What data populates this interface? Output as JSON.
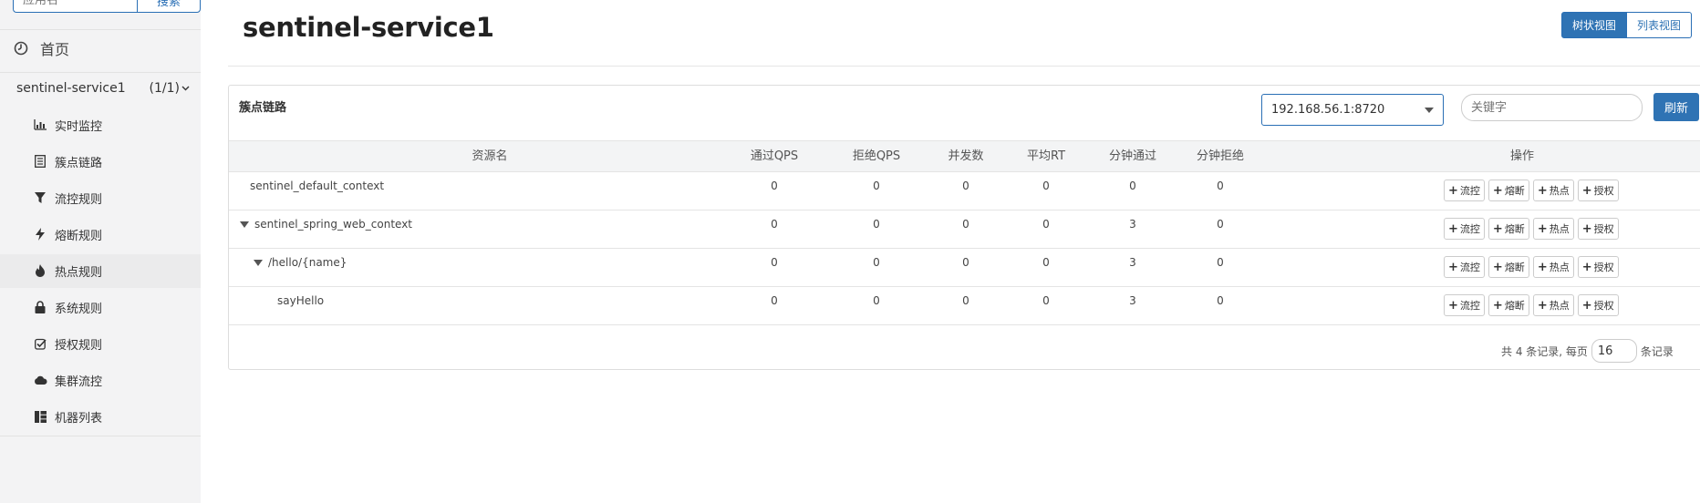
{
  "sidebar": {
    "search_placeholder": "应用名",
    "search_button": "搜索",
    "home_label": "首页",
    "app": {
      "name": "sentinel-service1",
      "count": "(1/1)"
    },
    "menu": [
      {
        "label": "实时监控",
        "icon": "bar-chart-icon"
      },
      {
        "label": "簇点链路",
        "icon": "list-icon"
      },
      {
        "label": "流控规则",
        "icon": "filter-icon"
      },
      {
        "label": "熔断规则",
        "icon": "bolt-icon"
      },
      {
        "label": "热点规则",
        "icon": "fire-icon"
      },
      {
        "label": "系统规则",
        "icon": "lock-icon"
      },
      {
        "label": "授权规则",
        "icon": "check-icon"
      },
      {
        "label": "集群流控",
        "icon": "cloud-icon"
      },
      {
        "label": "机器列表",
        "icon": "grid-icon"
      }
    ]
  },
  "header": {
    "title": "sentinel-service1",
    "tree_view": "树状视图",
    "list_view": "列表视图"
  },
  "panel": {
    "title": "簇点链路",
    "machine": "192.168.56.1:8720",
    "keyword_placeholder": "关键字",
    "refresh": "刷新"
  },
  "table": {
    "headers": [
      "资源名",
      "通过QPS",
      "拒绝QPS",
      "并发数",
      "平均RT",
      "分钟通过",
      "分钟拒绝",
      "操作"
    ],
    "rows": [
      {
        "name": "sentinel_default_context",
        "values": [
          "0",
          "0",
          "0",
          "0",
          "0",
          "0"
        ]
      },
      {
        "name": "sentinel_spring_web_context",
        "values": [
          "0",
          "0",
          "0",
          "0",
          "3",
          "0"
        ]
      },
      {
        "name": "/hello/{name}",
        "values": [
          "0",
          "0",
          "0",
          "0",
          "3",
          "0"
        ]
      },
      {
        "name": "sayHello",
        "values": [
          "0",
          "0",
          "0",
          "0",
          "3",
          "0"
        ]
      }
    ],
    "actions": [
      "流控",
      "熔断",
      "热点",
      "授权"
    ]
  },
  "pagination": {
    "prefix": "共 4 条记录, 每页",
    "page_size": "16",
    "suffix": "条记录"
  }
}
